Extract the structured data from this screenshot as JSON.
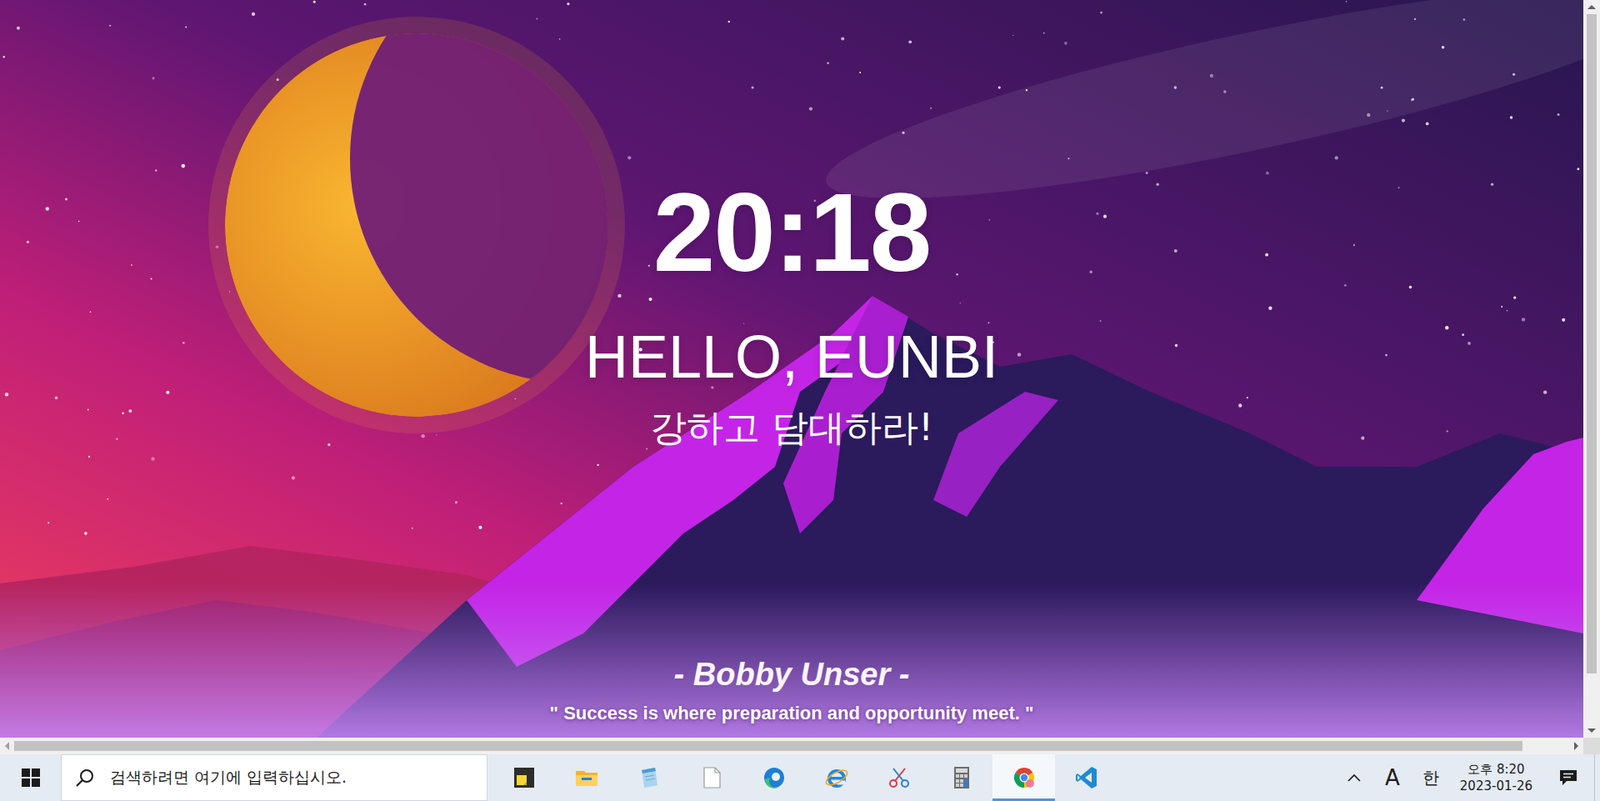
{
  "page": {
    "clock": "20:18",
    "greeting": "HELLO, EUNBI",
    "focus": "강하고 담대하라!",
    "quote": {
      "author": "- Bobby Unser -",
      "text": "\" Success is where preparation and opportunity meet. \""
    }
  },
  "scrollbars": {
    "vertical_level": 0.93,
    "horizontal_level": 0.97
  },
  "taskbar": {
    "search": {
      "placeholder": "검색하려면 여기에 입력하십시오."
    },
    "apps": [
      {
        "kind": "sticky",
        "active": false
      },
      {
        "kind": "explorer",
        "active": false
      },
      {
        "kind": "notepad",
        "active": false
      },
      {
        "kind": "file",
        "active": false
      },
      {
        "kind": "edge",
        "active": false
      },
      {
        "kind": "ie",
        "active": false
      },
      {
        "kind": "snipping",
        "active": false
      },
      {
        "kind": "calculator",
        "active": false
      },
      {
        "kind": "chrome",
        "active": true
      },
      {
        "kind": "vscode",
        "active": false
      }
    ],
    "tray": {
      "labels": [
        "A",
        "한"
      ],
      "time": "오후 8:20",
      "date": "2023-01-26"
    }
  }
}
